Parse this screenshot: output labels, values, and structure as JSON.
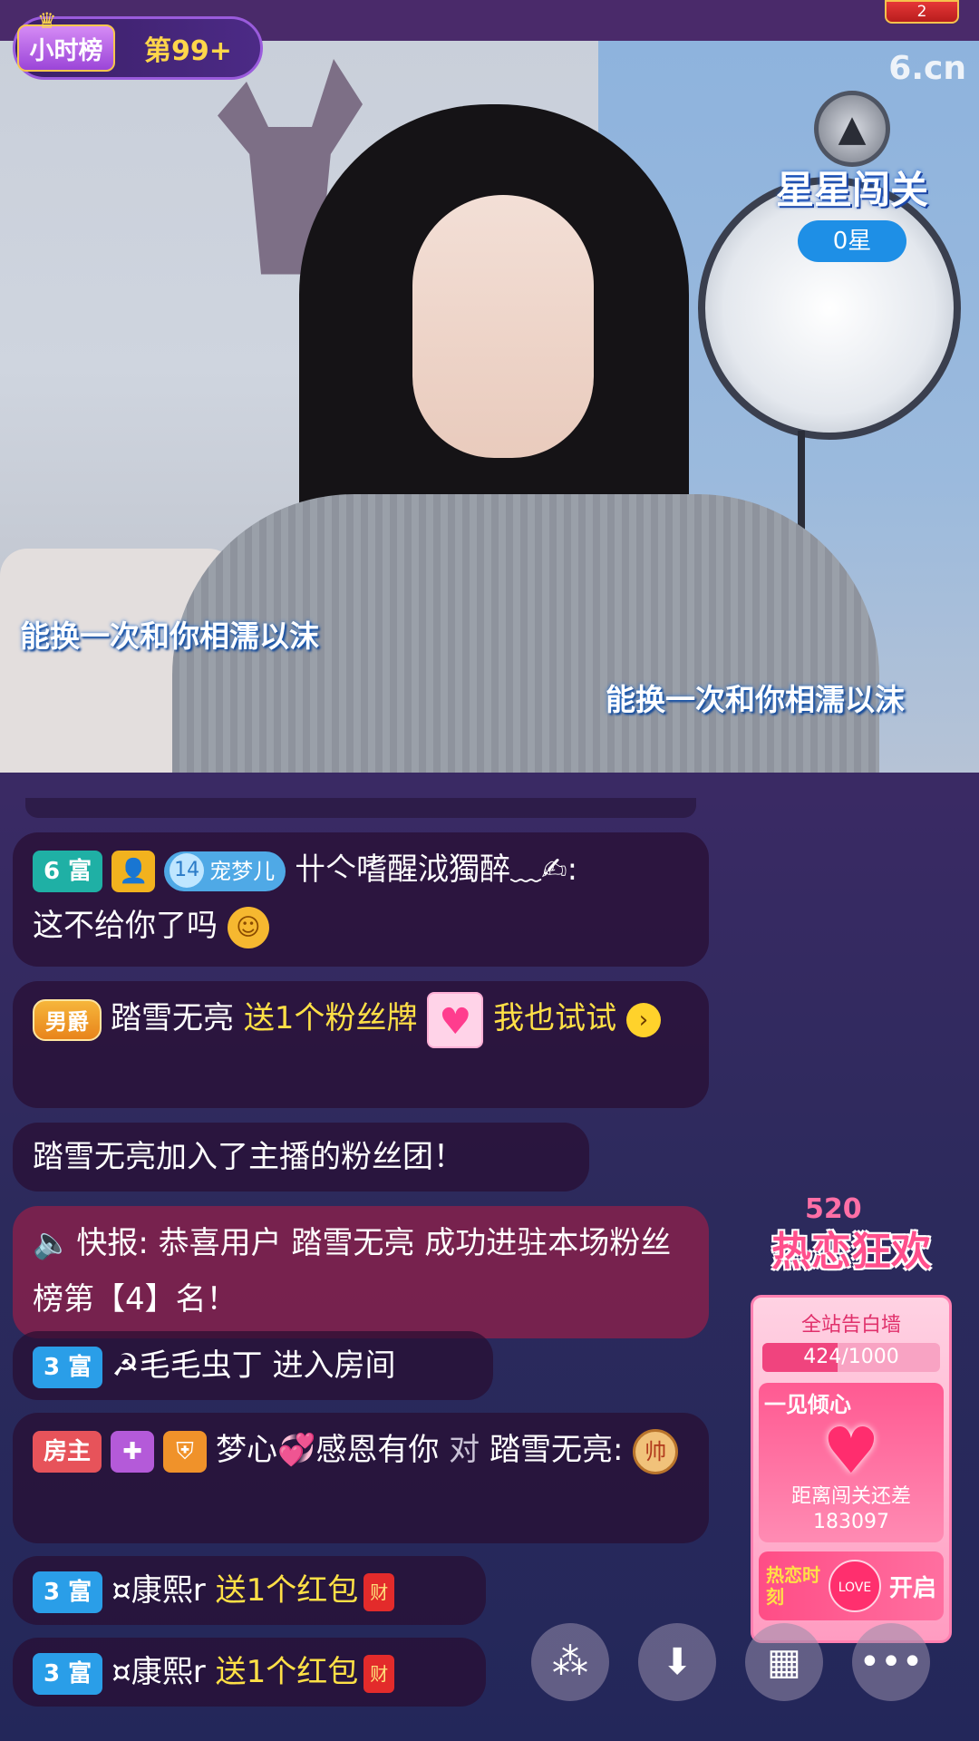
{
  "top": {
    "rank_label": "小时榜",
    "rank_value": "第99+",
    "corner_number": "2"
  },
  "video": {
    "watermark": "6.cn",
    "stars_title": "星星闯关",
    "stars_count": "0星",
    "lyric_line_1": "能换一次和你相濡以沫",
    "lyric_line_2": "能换一次和你相濡以沫"
  },
  "chat": [
    {
      "tag": "6 富",
      "fan_badge_level": "14",
      "fan_badge_name": "宠梦儿",
      "user": "卄亽嗜醒泧獨醉﹏✍:",
      "text": "这不给你了吗"
    },
    {
      "tag": "男爵",
      "user": "踏雪无亮",
      "action": "送1个粉丝牌",
      "text": "我也试试"
    },
    {
      "text": "踏雪无亮加入了主播的粉丝团！"
    },
    {
      "prefix": "快报:",
      "text": "恭喜用户 踏雪无亮 成功进驻本场粉丝榜第【4】名！"
    },
    {
      "tag": "3 富",
      "user": "☭毛毛虫丁",
      "text": "进入房间"
    },
    {
      "tag": "房主",
      "user": "梦心💞感恩有你",
      "connector": "对",
      "target": "踏雪无亮:",
      "chess": "帅"
    },
    {
      "tag": "3 富",
      "user": "¤康熙r",
      "action": "送1个红包",
      "env": "财"
    },
    {
      "tag": "3 富",
      "user": "¤康熙r",
      "action": "送1个红包",
      "env": "财"
    }
  ],
  "event": {
    "logo": "520",
    "title": "热恋狂欢",
    "wall_title": "全站告白墙",
    "progress_text": "424/1000",
    "progress_fraction": 0.424,
    "love_label": "一见倾心",
    "love_text_1": "距离闯关还差",
    "love_text_2": "183097",
    "footer_left": "热恋时刻",
    "footer_mid": "LOVE",
    "footer_right": "开启"
  },
  "colors": {
    "accent_yellow": "#ffe046",
    "rich6": "#1fb0a5",
    "rich3": "#2a9ee8",
    "owner": "#e7535a"
  },
  "buttons": {
    "share_icon": "share-icon",
    "download_icon": "download-icon",
    "grid_icon": "grid-icon",
    "more_icon": "more-icon"
  }
}
